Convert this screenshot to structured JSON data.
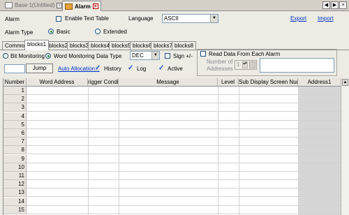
{
  "tabs": [
    {
      "label": "Base 1(Untitled)",
      "active": false
    },
    {
      "label": "Alarm",
      "active": true
    }
  ],
  "header": {
    "alarm_label": "Alarm",
    "enable_text_table": "Enable Text Table",
    "language_label": "Language",
    "language_value": "ASCII",
    "export_link": "Export",
    "import_link": "Import",
    "alarm_type_label": "Alarm Type",
    "type_basic": "Basic",
    "type_extended": "Extended",
    "selected_type": "Basic"
  },
  "block_tabs": [
    "Common",
    "blocks1",
    "blocks2",
    "blocks3",
    "blocks4",
    "blocks5",
    "blocks6",
    "blocks7",
    "blocks8"
  ],
  "active_block": "blocks1",
  "panel": {
    "bit_monitoring": "Bit Monitoring",
    "word_monitoring": "Word Monitoring",
    "data_type_label": "Data Type",
    "data_type_value": "DEC",
    "sign_label": "Sign +/-",
    "read_data_label": "Read Data From Each Alarm",
    "number_of_label": "Number of",
    "addresses_label": "Addresses",
    "address_count": "1",
    "jump_button": "Jump",
    "jump_value": "",
    "auto_allocation": "Auto Allocation...",
    "history": "History",
    "log": "Log",
    "active": "Active"
  },
  "table": {
    "columns": [
      "Number",
      "Word Address",
      "rigger Conditic",
      "Message",
      "Level",
      "Sub Display Screen Number",
      "Address1"
    ],
    "rows": [
      "1",
      "2",
      "3",
      "4",
      "5",
      "6",
      "7",
      "8",
      "9",
      "10",
      "11",
      "12",
      "13",
      "14",
      "15"
    ]
  },
  "icons": {
    "window_close": "close-icon",
    "scroll_up": "arrow-up-icon"
  }
}
